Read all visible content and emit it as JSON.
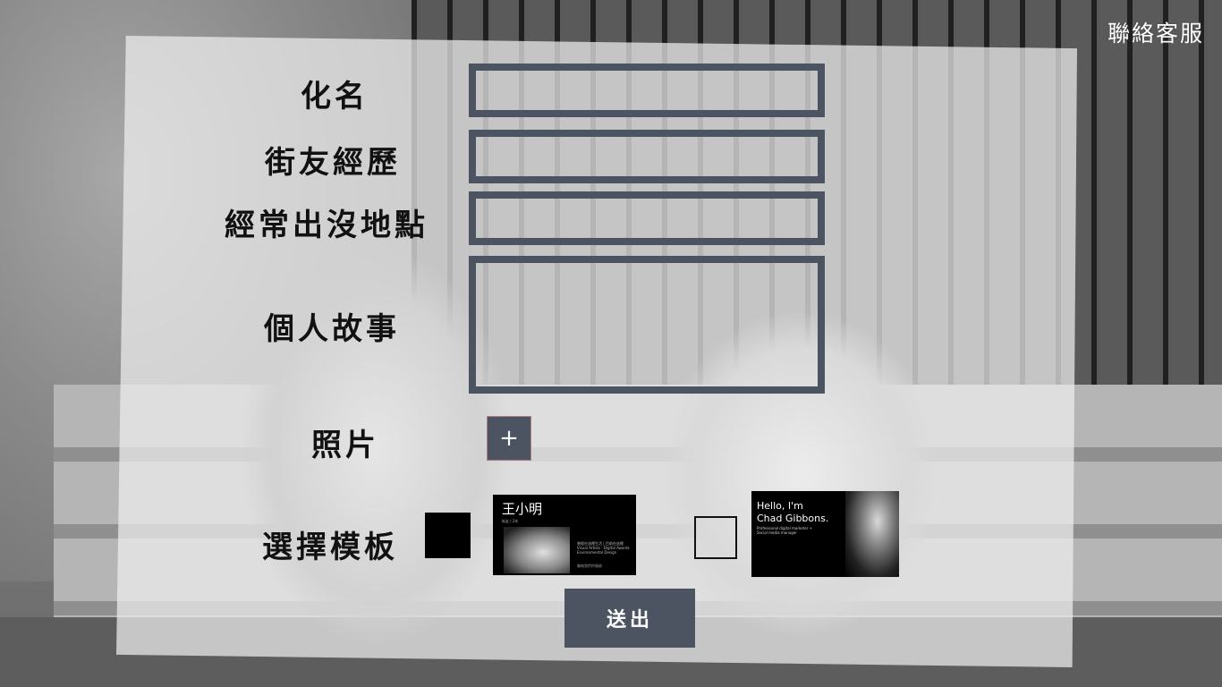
{
  "header": {
    "support_link": "聯絡客服"
  },
  "form": {
    "alias_label": "化名",
    "experience_label": "街友經歷",
    "location_label": "經常出沒地點",
    "story_label": "個人故事",
    "photo_label": "照片",
    "add_photo_icon": "plus-icon",
    "add_photo_glyph": "+",
    "template_label": "選擇模板",
    "submit_label": "送出"
  },
  "templates": [
    {
      "name": "王小明",
      "subtitle": "街友 | 2年",
      "line1": "曾經在這裡生活 | 目前在這裡",
      "line2": "Visual Artists · Digital Awards",
      "line3": "Environmental Design",
      "line4": "聯絡我們的服務",
      "selected": true
    },
    {
      "hello": "Hello, I'm",
      "name": "Chad Gibbons.",
      "desc": "Professional digital marketer + Social media manager",
      "selected": false
    }
  ],
  "colors": {
    "accent": "#4b5460",
    "panel": "#eeeeee",
    "text": "#111111"
  }
}
